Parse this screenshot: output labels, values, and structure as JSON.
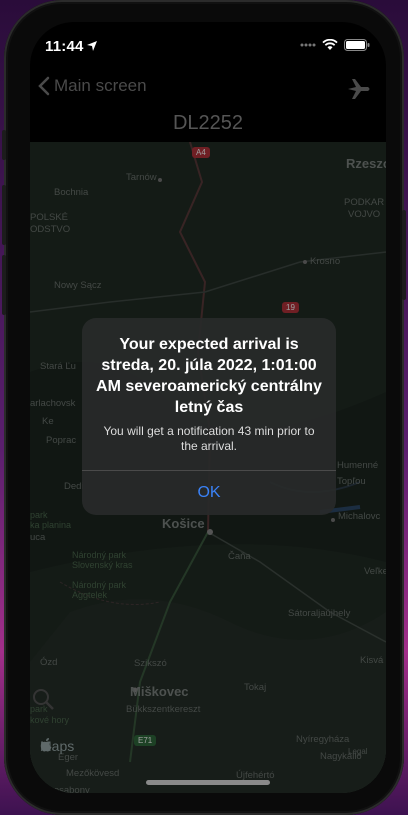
{
  "status_bar": {
    "time": "11:44"
  },
  "nav": {
    "back_label": "Main screen",
    "plane_icon": "airplane-icon"
  },
  "title": "DL2252",
  "map": {
    "labels": [
      {
        "text": "Rzeszo",
        "cls": "big"
      },
      {
        "text": "Tarnów"
      },
      {
        "text": "Bochnia"
      },
      {
        "text": "POLSKÉ"
      },
      {
        "text": "ODSTVO"
      },
      {
        "text": "PODKAR"
      },
      {
        "text": "VOJVO"
      },
      {
        "text": "Krosno"
      },
      {
        "text": "Nowy Sącz"
      },
      {
        "text": "Stará Ľu"
      },
      {
        "text": "arlachovsk"
      },
      {
        "text": "Ke"
      },
      {
        "text": "Poprac"
      },
      {
        "text": "Dedi"
      },
      {
        "text": "Humenné"
      },
      {
        "text": "Topľou"
      },
      {
        "text": "Košice",
        "cls": "big"
      },
      {
        "text": "Michalovc"
      },
      {
        "text": "Čaňa"
      },
      {
        "text": "Veľke"
      },
      {
        "text": "Národný park Slovenský kras"
      },
      {
        "text": "Národný park Aggtelek"
      },
      {
        "text": "park"
      },
      {
        "text": "ka planina"
      },
      {
        "text": "uca"
      },
      {
        "text": "Sátoraljaújhely"
      },
      {
        "text": "Ózd"
      },
      {
        "text": "Szikszó"
      },
      {
        "text": "Kisvá"
      },
      {
        "text": "Tokaj"
      },
      {
        "text": "Miškovec",
        "cls": "big"
      },
      {
        "text": "Bükkszentkereszt"
      },
      {
        "text": "park"
      },
      {
        "text": "kové hory"
      },
      {
        "text": "Eger"
      },
      {
        "text": "Nyíregyháza"
      },
      {
        "text": "Nagykálló"
      },
      {
        "text": "Mezőkövesd"
      },
      {
        "text": "Újfehértó"
      },
      {
        "text": "Füzesabony"
      }
    ],
    "road_badges": [
      {
        "text": "A4",
        "color": "#b4323a"
      },
      {
        "text": "19",
        "color": "#b4323a"
      },
      {
        "text": "E71",
        "color": "#2f6a3c"
      }
    ],
    "maps_logo_text": "Maps",
    "legal_text": "Legal"
  },
  "alert": {
    "title": "Your expected arrival is streda, 20. júla 2022, 1:01:00 AM severoamerický centrálny letný čas",
    "message": "You will get a notification 43 min prior to the arrival.",
    "ok_label": "OK"
  },
  "colors": {
    "accent": "#3a82f7"
  }
}
